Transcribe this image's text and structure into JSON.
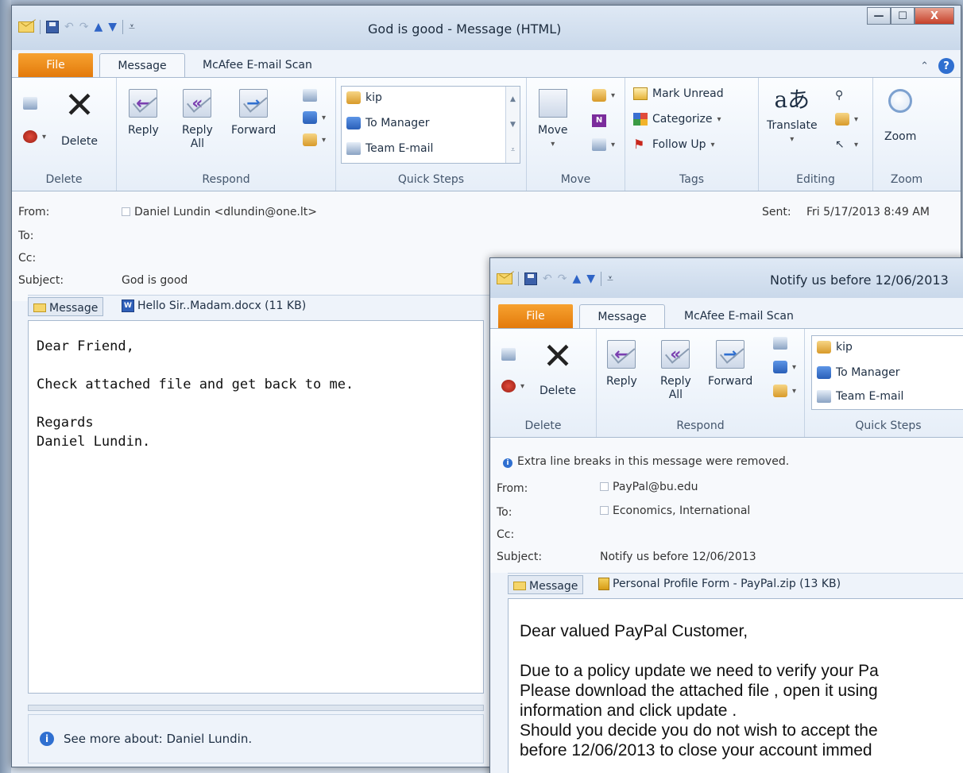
{
  "win1": {
    "title": "God is good  -  Message (HTML)",
    "controls": {
      "minimize": "—",
      "maximize": "☐",
      "close": "X"
    },
    "tabs": {
      "file": "File",
      "message": "Message",
      "mcafee": "McAfee E-mail Scan"
    },
    "ribbon": {
      "delete_group": {
        "label": "Delete",
        "delete": "Delete"
      },
      "respond_group": {
        "label": "Respond",
        "reply": "Reply",
        "reply_all_1": "Reply",
        "reply_all_2": "All",
        "forward": "Forward"
      },
      "quick_steps_group": {
        "label": "Quick Steps",
        "items": [
          "kip",
          "To Manager",
          "Team E-mail"
        ]
      },
      "move_group": {
        "label": "Move",
        "move": "Move"
      },
      "tags_group": {
        "label": "Tags",
        "mark_unread": "Mark Unread",
        "categorize": "Categorize",
        "follow_up": "Follow Up"
      },
      "editing_group": {
        "label": "Editing",
        "translate": "Translate"
      },
      "zoom_group": {
        "label": "Zoom",
        "zoom": "Zoom"
      }
    },
    "headers": {
      "from_label": "From:",
      "from_value": "Daniel Lundin <dlundin@one.lt>",
      "to_label": "To:",
      "cc_label": "Cc:",
      "subject_label": "Subject:",
      "subject_value": "God is good",
      "sent_label": "Sent:",
      "sent_value": "Fri 5/17/2013 8:49 AM"
    },
    "attachments": {
      "message_tab": "Message",
      "file": "Hello Sir..Madam.docx (11 KB)"
    },
    "body": "Dear Friend,\n\nCheck attached file and get back to me.\n\nRegards\nDaniel Lundin.",
    "people_pane": "See more about: Daniel Lundin."
  },
  "win2": {
    "title": "Notify us before 12/06/2013",
    "tabs": {
      "file": "File",
      "message": "Message",
      "mcafee": "McAfee E-mail Scan"
    },
    "ribbon": {
      "delete_group": {
        "label": "Delete",
        "delete": "Delete"
      },
      "respond_group": {
        "label": "Respond",
        "reply": "Reply",
        "reply_all_1": "Reply",
        "reply_all_2": "All",
        "forward": "Forward"
      },
      "quick_steps_group": {
        "label": "Quick Steps",
        "items": [
          "kip",
          "To Manager",
          "Team E-mail"
        ]
      }
    },
    "headers": {
      "notice": "Extra line breaks in this message were removed.",
      "from_label": "From:",
      "from_value": "PayPal@bu.edu",
      "to_label": "To:",
      "to_value": "Economics, International",
      "cc_label": "Cc:",
      "subject_label": "Subject:",
      "subject_value": "Notify us before 12/06/2013"
    },
    "attachments": {
      "message_tab": "Message",
      "file": "Personal Profile Form - PayPal.zip (13 KB)"
    },
    "body": "Dear valued PayPal Customer,\n\nDue to a policy update we need to verify your Pa\nPlease download the attached file , open it using\ninformation and click update .\nShould you decide you do not wish to accept the\nbefore 12/06/2013 to close your account immed"
  }
}
